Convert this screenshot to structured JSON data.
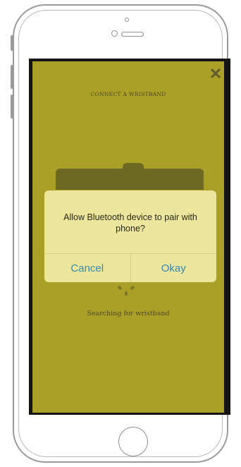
{
  "screen": {
    "title": "CONNECT A WRISTBAND",
    "close_icon": "✕",
    "status": "Searching for wristband"
  },
  "dialog": {
    "message": "Allow Bluetooth device to pair with phone?",
    "cancel_label": "Cancel",
    "ok_label": "Okay"
  },
  "colors": {
    "overlay": "#aaa028",
    "dialog_bg": "#ebe69b",
    "button_text": "#3a88b4"
  }
}
